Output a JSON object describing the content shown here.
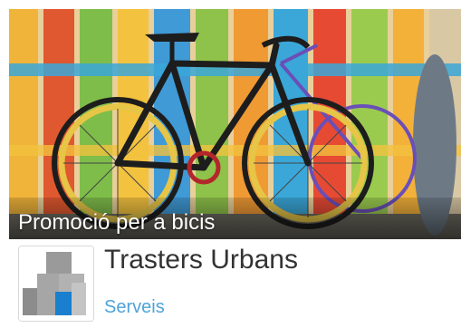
{
  "promo": {
    "title": "Promoció per a bicis"
  },
  "listing": {
    "name": "Trasters Urbans",
    "category": "Serveis"
  },
  "colors": {
    "category_link": "#4fa3d9",
    "logo_blue": "#1a7fcf",
    "logo_gray": "#8c8c8c"
  },
  "icons": {
    "logo": "trasters-urbans-logo",
    "hero": "bicycle-photo"
  }
}
